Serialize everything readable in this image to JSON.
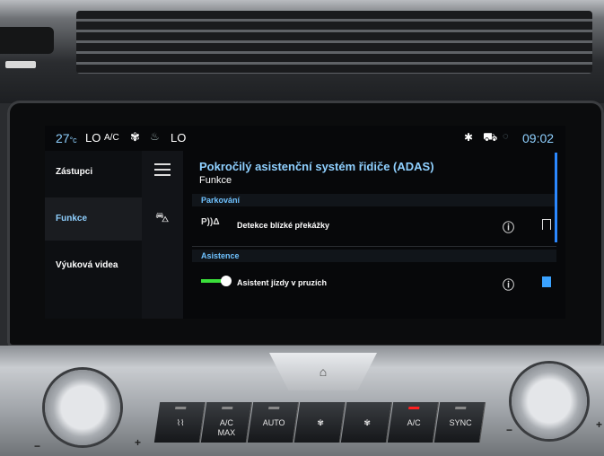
{
  "status": {
    "temp_left": "27",
    "temp_unit": "°c",
    "lo_left": "LO",
    "ac": "A/C",
    "fan_icon": "fan-icon",
    "seat_icon": "seat-heat-icon",
    "lo_right": "LO",
    "bluetooth_icon": "bluetooth-icon",
    "car_icon": "car-icon",
    "signal_icon": "signal-icon",
    "time": "09:02"
  },
  "sidebar": {
    "items": [
      {
        "label": "Zástupci"
      },
      {
        "label": "Funkce"
      },
      {
        "label": "Výuková videa"
      }
    ]
  },
  "main": {
    "title": "Pokročilý asistenční systém řidiče (ADAS)",
    "subtitle": "Funkce",
    "sections": [
      {
        "label": "Parkování"
      },
      {
        "label": "Asistence"
      }
    ],
    "rows": [
      {
        "label": "Detekce blízké překážky",
        "icon_text": "P))Δ"
      },
      {
        "label": "Asistent jízdy v pruzích"
      }
    ]
  },
  "controls": {
    "labels": [
      "A/C\nMAX",
      "AUTO",
      "A/C",
      "SYNC"
    ]
  },
  "colors": {
    "accent": "#8fd0ff",
    "toggle_on": "#3adf3a",
    "bookmark_on": "#3aa2ff"
  }
}
